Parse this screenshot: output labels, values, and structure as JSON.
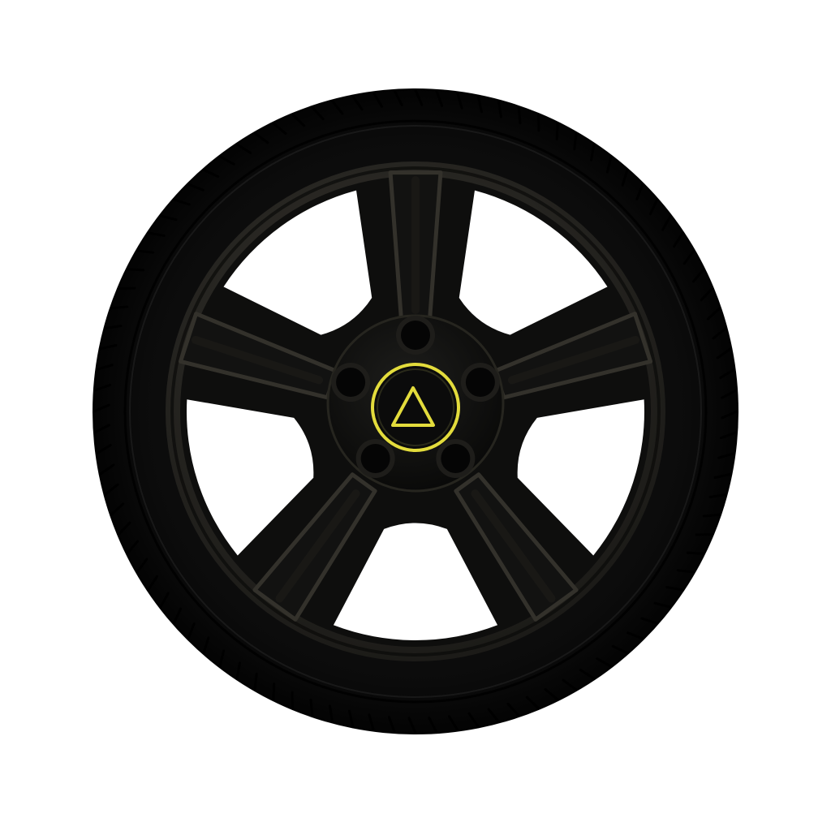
{
  "scene": {
    "subject": "wheel-with-tire",
    "spoke_count": 5,
    "lug_nut_count": 5,
    "hub_cap_symbol": "triangle-icon"
  },
  "colors": {
    "background": "#ffffff",
    "tire": "#0a0a0a",
    "tire_edge": "#151515",
    "tread_groove": "#000000",
    "rim_lip": "#2b2925",
    "rim_inner": "#0d0d0c",
    "spoke": "#121211",
    "spoke_edge": "#33312b",
    "hub": "#0f0f0e",
    "lug_hole": "#050505",
    "hub_cap": "#0b0b0b",
    "hub_cap_accent": "#e3dc3c"
  }
}
